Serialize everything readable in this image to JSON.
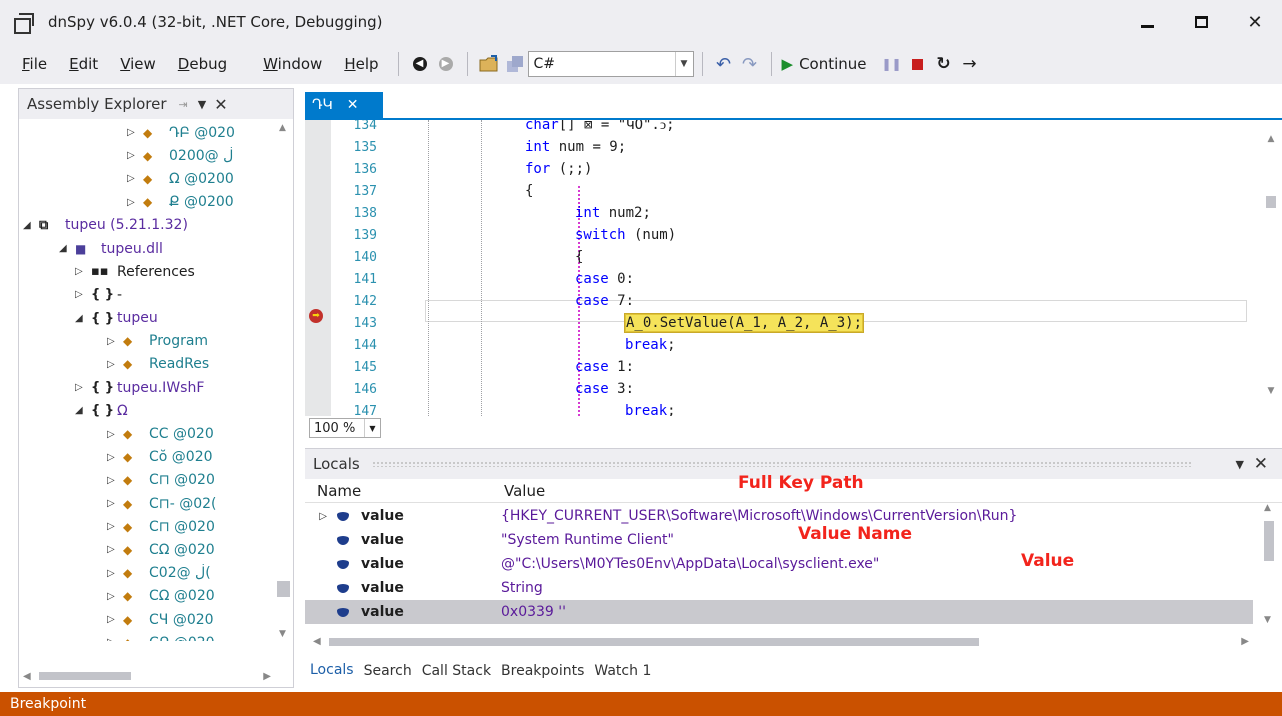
{
  "window": {
    "title": "dnSpy v6.0.4 (32-bit, .NET Core, Debugging)",
    "min_glyph": "",
    "close_glyph": "✕"
  },
  "menu": {
    "items": [
      {
        "label": "File",
        "key": "F",
        "rest": "ile"
      },
      {
        "label": "Edit",
        "key": "E",
        "rest": "dit"
      },
      {
        "label": "View",
        "key": "V",
        "rest": "iew"
      },
      {
        "label": "Debug",
        "key": "D",
        "rest": "ebug"
      },
      {
        "label": "Window",
        "key": "W",
        "rest": "indow"
      },
      {
        "label": "Help",
        "key": "H",
        "rest": "elp"
      }
    ]
  },
  "toolbar": {
    "language": "C#",
    "continue_label": "Continue"
  },
  "assembly_explorer": {
    "title": "Assembly Explorer",
    "rows": [
      {
        "exp": "▷",
        "icon": "class",
        "text": "ԴԲ @020",
        "color": "teal",
        "indent": 108
      },
      {
        "exp": "▷",
        "icon": "class",
        "text": "ڶ @0200",
        "color": "teal",
        "indent": 108
      },
      {
        "exp": "▷",
        "icon": "class",
        "text": "Ω @0200",
        "color": "teal",
        "indent": 108
      },
      {
        "exp": "▷",
        "icon": "class",
        "text": "Ք @0200",
        "color": "teal",
        "indent": 108
      },
      {
        "exp": "◢",
        "icon": "assembly",
        "text": "tupeu (5.21.1.32)",
        "color": "purple",
        "indent": 4
      },
      {
        "exp": "◢",
        "icon": "dll",
        "text": "tupeu.dll",
        "color": "purple",
        "indent": 40
      },
      {
        "exp": "▷",
        "icon": "refs",
        "text": "References",
        "color": "black",
        "indent": 56
      },
      {
        "exp": "▷",
        "icon": "ns",
        "text": "-",
        "color": "black",
        "indent": 56
      },
      {
        "exp": "◢",
        "icon": "ns",
        "text": "tupeu",
        "color": "purple",
        "indent": 56
      },
      {
        "exp": "▷",
        "icon": "class2",
        "text": "Program",
        "color": "teal",
        "indent": 88
      },
      {
        "exp": "▷",
        "icon": "class2",
        "text": "ReadRes",
        "color": "teal",
        "indent": 88
      },
      {
        "exp": "▷",
        "icon": "ns",
        "text": "tupeu.IWshF",
        "color": "purple",
        "indent": 56
      },
      {
        "exp": "◢",
        "icon": "ns",
        "text": "Ω",
        "color": "purple",
        "indent": 56
      },
      {
        "exp": "▷",
        "icon": "class",
        "text": "CC @020",
        "color": "teal",
        "indent": 88
      },
      {
        "exp": "▷",
        "icon": "class",
        "text": "Cŏ @020",
        "color": "teal",
        "indent": 88
      },
      {
        "exp": "▷",
        "icon": "class",
        "text": "C⊓ @020",
        "color": "teal",
        "indent": 88
      },
      {
        "exp": "▷",
        "icon": "class",
        "text": "C⊓- @02(",
        "color": "teal",
        "indent": 88
      },
      {
        "exp": "▷",
        "icon": "class",
        "text": "C⊓ @020",
        "color": "teal",
        "indent": 88
      },
      {
        "exp": "▷",
        "icon": "class",
        "text": "CΩ @020",
        "color": "teal",
        "indent": 88
      },
      {
        "exp": "▷",
        "icon": "class",
        "text": "Cڶ @02(",
        "color": "teal",
        "indent": 88
      },
      {
        "exp": "▷",
        "icon": "class",
        "text": "CΩ @020",
        "color": "teal",
        "indent": 88
      },
      {
        "exp": "▷",
        "icon": "class",
        "text": "CЧ @020",
        "color": "teal",
        "indent": 88
      },
      {
        "exp": "▷",
        "icon": "class",
        "text": "CՔ @020",
        "color": "teal",
        "indent": 88
      }
    ]
  },
  "editor": {
    "tab_label": "ԴԿ",
    "zoom": "100 %",
    "lines": [
      {
        "n": "134",
        "code": "char[] ⊠ = \"ԿՕ\".ↄ;",
        "indent": 0
      },
      {
        "n": "135",
        "code": "int num = 9;",
        "indent": 0
      },
      {
        "n": "136",
        "code": "for (;;)",
        "indent": 0
      },
      {
        "n": "137",
        "code": "{",
        "indent": 0
      },
      {
        "n": "138",
        "code": "int num2;",
        "indent": 1
      },
      {
        "n": "139",
        "code": "switch (num)",
        "indent": 1
      },
      {
        "n": "140",
        "code": "{",
        "indent": 1
      },
      {
        "n": "141",
        "code": "case 0:",
        "indent": 1
      },
      {
        "n": "142",
        "code": "case 7:",
        "indent": 1
      },
      {
        "n": "143",
        "code": "A_0.SetValue(A_1, A_2, A_3);",
        "indent": 2
      },
      {
        "n": "144",
        "code": "break;",
        "indent": 2
      },
      {
        "n": "145",
        "code": "case 1:",
        "indent": 1
      },
      {
        "n": "146",
        "code": "case 3:",
        "indent": 1
      },
      {
        "n": "147",
        "code": "break;",
        "indent": 2
      }
    ]
  },
  "locals": {
    "title": "Locals",
    "col_name": "Name",
    "col_value": "Value",
    "rows": [
      {
        "exp": "▷",
        "name": "value",
        "value": "{HKEY_CURRENT_USER\\Software\\Microsoft\\Windows\\CurrentVersion\\Run}",
        "selected": false
      },
      {
        "exp": "",
        "name": "value",
        "value": "\"System Runtime Client\"",
        "selected": false
      },
      {
        "exp": "",
        "name": "value",
        "value": "@\"C:\\Users\\M0YTes0Env\\AppData\\Local\\sysclient.exe\"",
        "selected": false
      },
      {
        "exp": "",
        "name": "value",
        "value": "String",
        "selected": false
      },
      {
        "exp": "",
        "name": "value",
        "value": "0x0339 ''",
        "selected": true
      }
    ],
    "annotations": {
      "full_key_path": "Full Key Path",
      "value_name": "Value Name",
      "value": "Value"
    },
    "tabs": [
      "Locals",
      "Search",
      "Call Stack",
      "Breakpoints",
      "Watch 1"
    ]
  },
  "status": {
    "text": "Breakpoint"
  },
  "colors": {
    "accent": "#007acc",
    "status_bar": "#ca5100",
    "annotation": "#f2241c",
    "highlight": "#f5e35a"
  }
}
